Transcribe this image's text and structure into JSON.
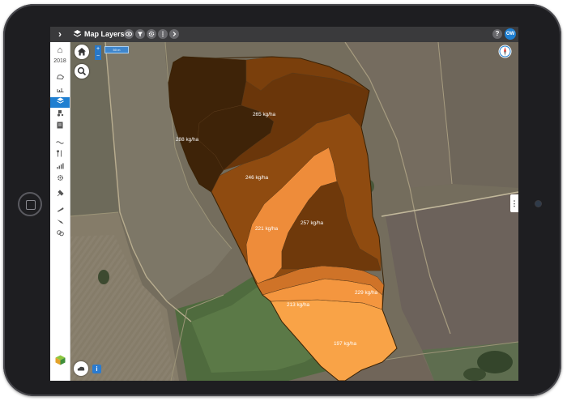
{
  "topbar": {
    "title": "Map Layers",
    "expand_icon": "chevron-right-icon",
    "tools": [
      "eye-icon",
      "filter-icon",
      "gear-icon",
      "more-icon",
      "chevron-right-icon"
    ],
    "help_label": "?",
    "user_initials": "OW"
  },
  "sidebar": {
    "year": "2018",
    "items": [
      "home-icon",
      "field-boundary-icon",
      "soil-icon",
      "layers-icon",
      "tractor-icon",
      "notes-icon",
      "weather-icon",
      "fork-icon",
      "yield-icon",
      "gear-icon",
      "spray-icon",
      "seed-icon",
      "harvest-icon",
      "fertilizer-icon"
    ],
    "active_item": "layers-icon"
  },
  "map": {
    "scale_label": "50 m",
    "zoom_in_label": "+",
    "zoom_out_label": "−",
    "info_label": "i",
    "panel_toggle_label": "⋮",
    "zones": [
      {
        "label": "288 kg/ha",
        "color": "#3e2308"
      },
      {
        "label": "265 kg/ha",
        "color": "#6a360a"
      },
      {
        "label": "246 kg/ha",
        "color": "#8f4b10"
      },
      {
        "label": "221 kg/ha",
        "color": "#ee8c3a"
      },
      {
        "label": "257 kg/ha",
        "color": "#6f390b"
      },
      {
        "label": "229 kg/ha",
        "color": "#cf7328"
      },
      {
        "label": "213 kg/ha",
        "color": "#f4963f"
      },
      {
        "label": "197 kg/ha",
        "color": "#f9a347"
      }
    ]
  },
  "colors": {
    "accent": "#1f7fd1",
    "topbar": "#3a3a3c",
    "tablet_bezel": "#1e1e21"
  }
}
